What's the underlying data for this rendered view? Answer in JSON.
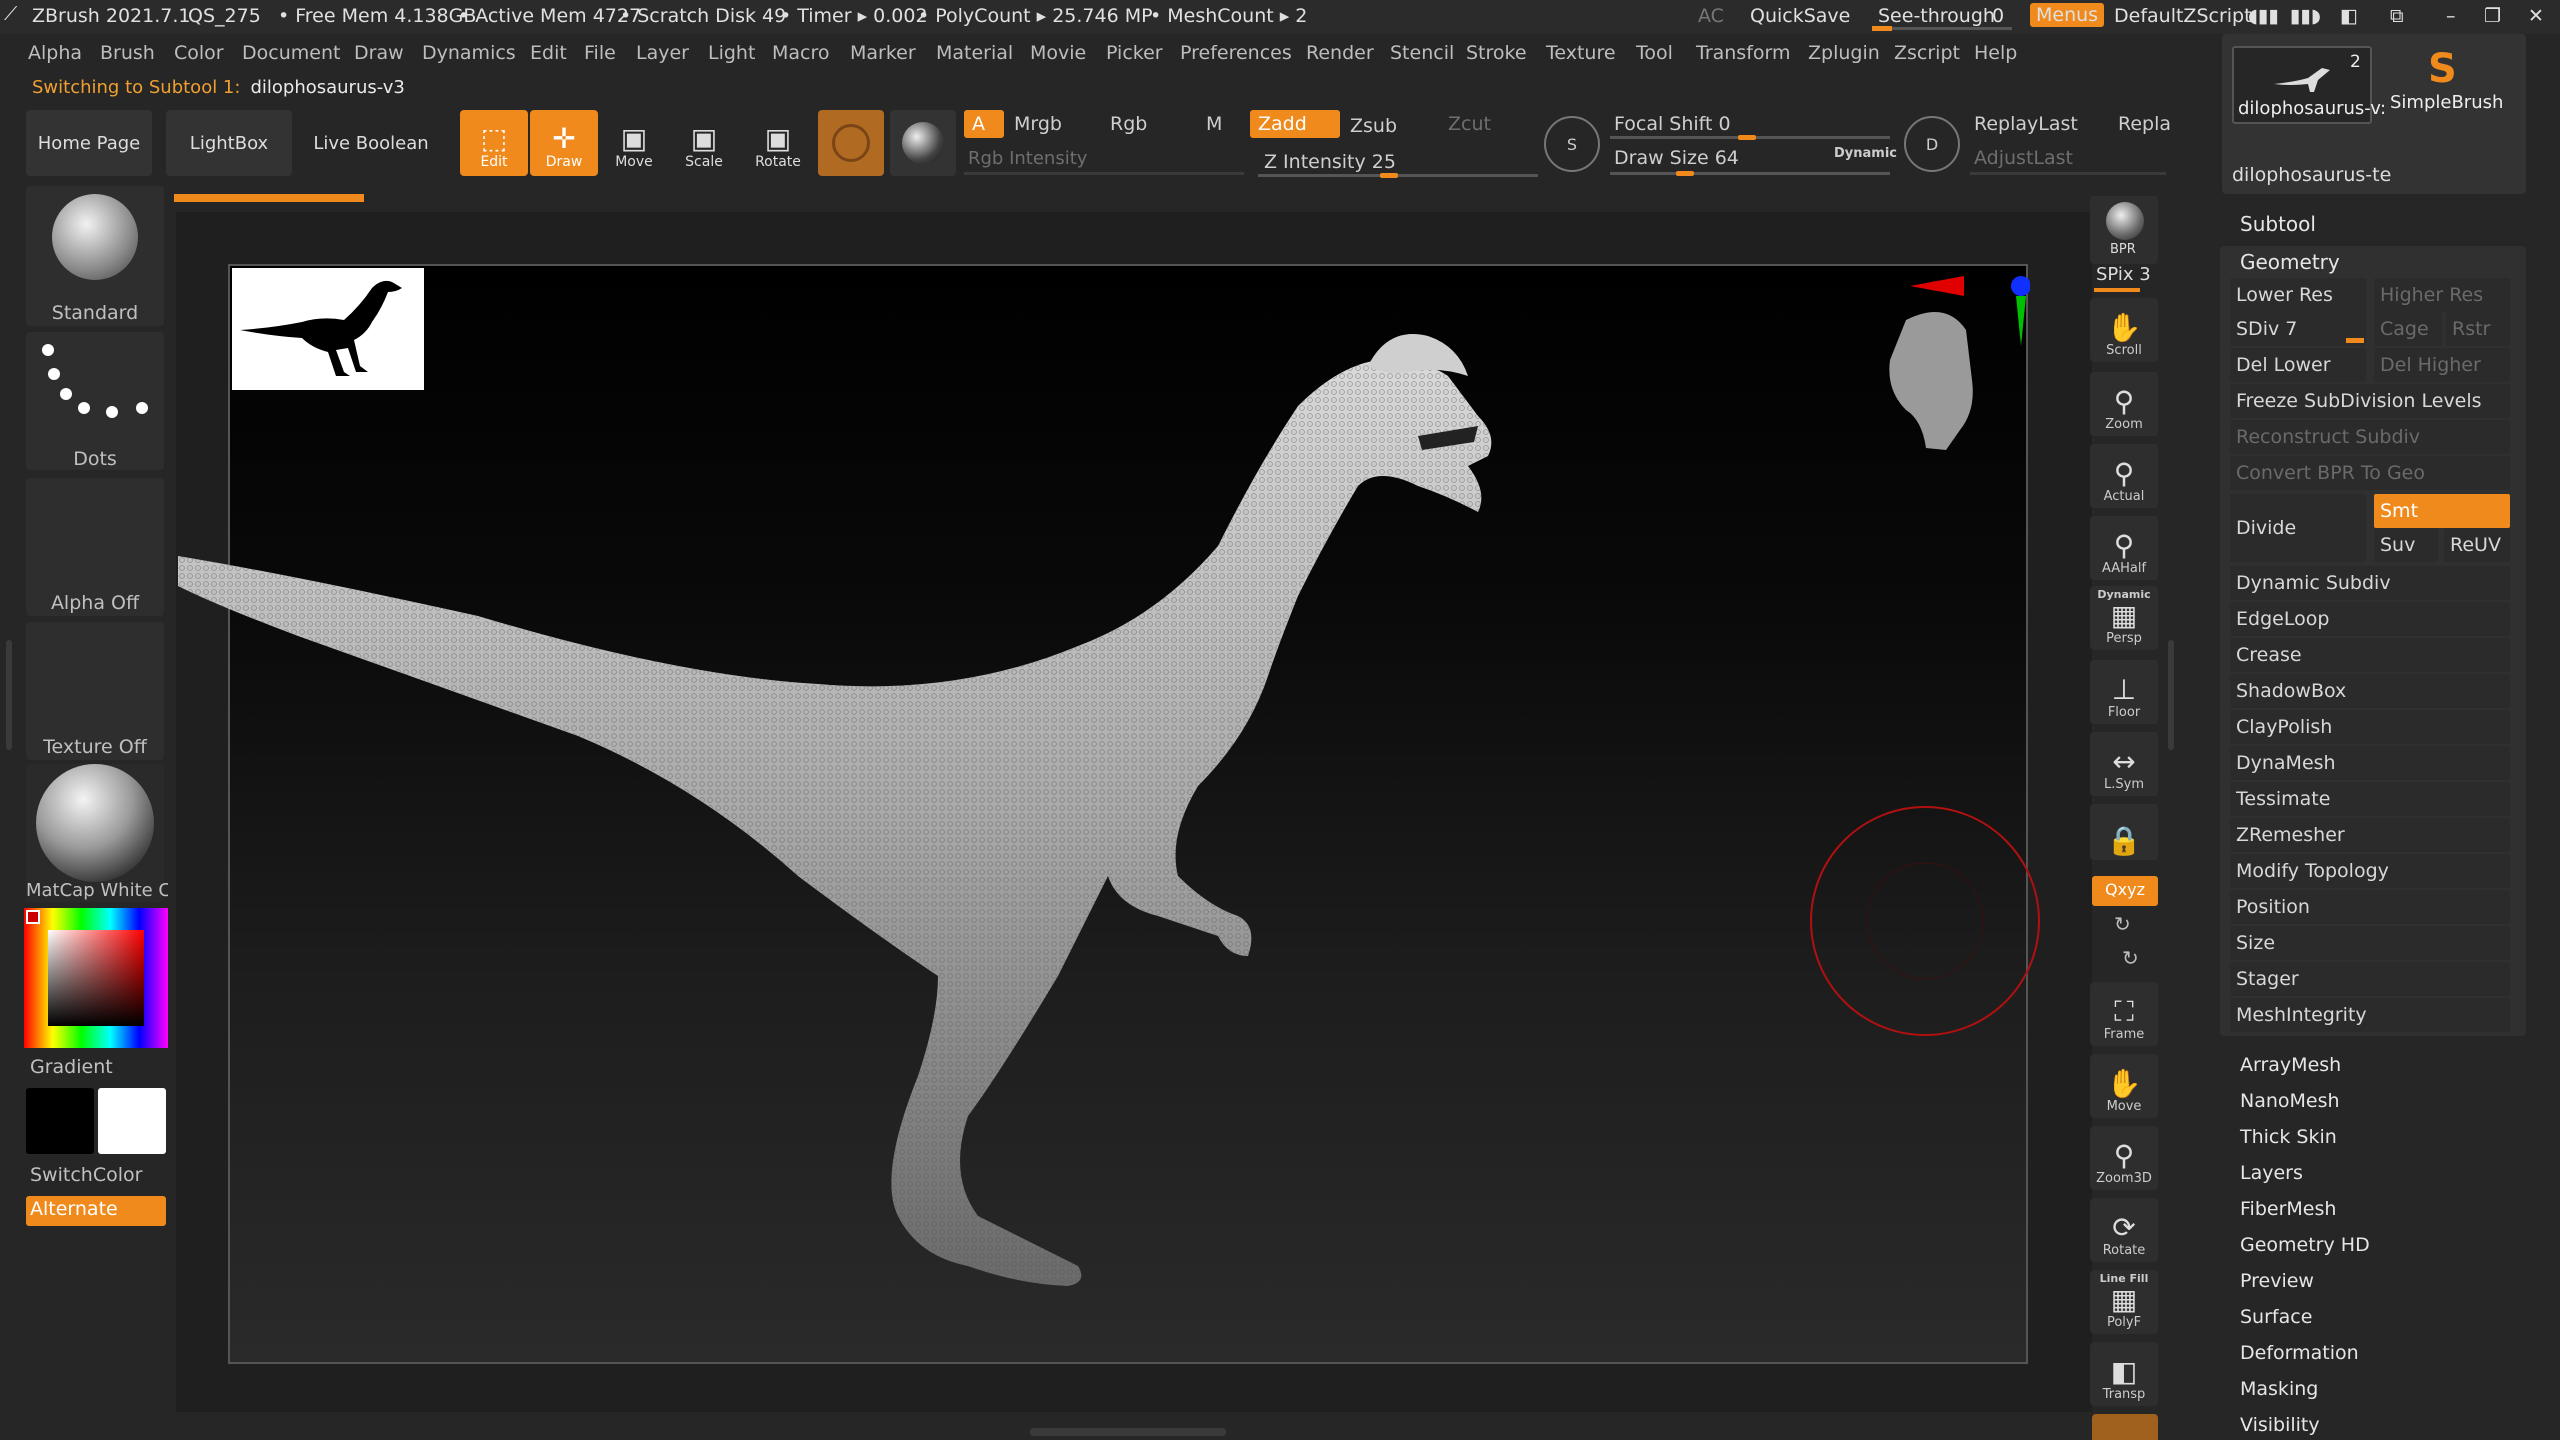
{
  "titlebar": {
    "app": "ZBrush 2021.7.1",
    "project": "QS_275",
    "free_mem": "• Free Mem 4.138GB",
    "active_mem": "• Active Mem 4727",
    "scratch_disk": "• Scratch Disk 49",
    "timer": "• Timer ▸ 0.002",
    "polycount": "• PolyCount ▸ 25.746 MP",
    "meshcount": "• MeshCount ▸ 2",
    "ac": "AC",
    "quicksave": "QuickSave",
    "see_through_label": "See-through",
    "see_through_value": "0",
    "menus": "Menus",
    "default_zscript": "DefaultZScript"
  },
  "menubar": [
    "Alpha",
    "Brush",
    "Color",
    "Document",
    "Draw",
    "Dynamics",
    "Edit",
    "File",
    "Layer",
    "Light",
    "Macro",
    "Marker",
    "Material",
    "Movie",
    "Picker",
    "Preferences",
    "Render",
    "Stencil",
    "Stroke",
    "Texture",
    "Tool",
    "Transform",
    "Zplugin",
    "Zscript",
    "Help"
  ],
  "status": {
    "switching_label": "Switching to Subtool 1:",
    "switching_value": "dilophosaurus-v3"
  },
  "toolbar": {
    "home_page": "Home Page",
    "lightbox": "LightBox",
    "live_boolean": "Live Boolean",
    "edit": "Edit",
    "draw": "Draw",
    "move": "Move",
    "scale": "Scale",
    "rotate": "Rotate",
    "a": "A",
    "mrgb": "Mrgb",
    "rgb": "Rgb",
    "m": "M",
    "zadd": "Zadd",
    "zsub": "Zsub",
    "zcut": "Zcut",
    "rgb_intensity": "Rgb Intensity",
    "z_intensity": "Z Intensity 25",
    "focal_shift": "Focal Shift 0",
    "draw_size": "Draw Size 64",
    "dynamic": "Dynamic",
    "replay_last": "ReplayLast",
    "repla": "Repla",
    "adjust_last": "AdjustLast"
  },
  "left_shelf": {
    "brush": "Standard",
    "stroke": "Dots",
    "alpha": "Alpha Off",
    "texture": "Texture Off",
    "material": "MatCap White C",
    "gradient": "Gradient",
    "switch_color": "SwitchColor",
    "alternate": "Alternate",
    "colors": {
      "main": "#000000",
      "secondary": "#ffffff",
      "accent": "#f08a1c"
    }
  },
  "right_dock": {
    "bpr": "BPR",
    "spix": "SPix 3",
    "buttons": [
      "Scroll",
      "Zoom",
      "Actual",
      "AAHalf",
      "Persp",
      "Floor",
      "L.Sym",
      "Frame",
      "Move",
      "Zoom3D",
      "Rotate",
      "PolyF",
      "Transp"
    ],
    "dynamic_label": "Dynamic",
    "xyz": "Qxyz",
    "line_fill": "Line Fill"
  },
  "tool_palette": {
    "subtool_thumb_count": "2",
    "subtool_thumb_name": "dilophosaurus-v:",
    "simple_brush": "SimpleBrush",
    "subtool_name_2": "dilophosaurus-te",
    "subtool_header": "Subtool",
    "geometry_header": "Geometry",
    "lower_res": "Lower Res",
    "higher_res": "Higher Res",
    "sdiv": "SDiv 7",
    "cage": "Cage",
    "rstr": "Rstr",
    "del_lower": "Del Lower",
    "del_higher": "Del Higher",
    "freeze": "Freeze SubDivision Levels",
    "reconstruct": "Reconstruct Subdiv",
    "convert_bpr": "Convert BPR To Geo",
    "divide": "Divide",
    "smt": "Smt",
    "suv": "Suv",
    "reuv": "ReUV",
    "geometry_items": [
      "Dynamic Subdiv",
      "EdgeLoop",
      "Crease",
      "ShadowBox",
      "ClayPolish",
      "DynaMesh",
      "Tessimate",
      "ZRemesher",
      "Modify Topology",
      "Position",
      "Size",
      "Stager",
      "MeshIntegrity"
    ],
    "subpalettes": [
      "ArrayMesh",
      "NanoMesh",
      "Thick Skin",
      "Layers",
      "FiberMesh",
      "Geometry HD",
      "Preview",
      "Surface",
      "Deformation",
      "Masking",
      "Visibility"
    ]
  }
}
